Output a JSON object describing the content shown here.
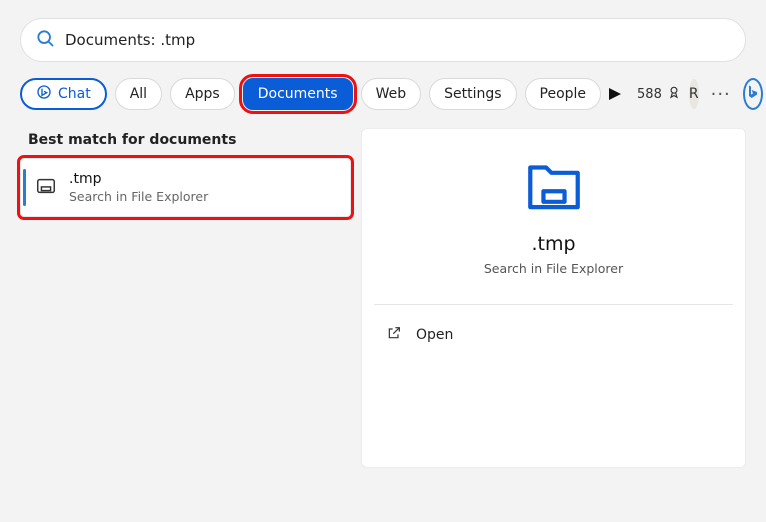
{
  "search": {
    "value": "Documents: .tmp"
  },
  "filters": {
    "chat": "Chat",
    "all": "All",
    "apps": "Apps",
    "documents": "Documents",
    "web": "Web",
    "settings": "Settings",
    "people": "People"
  },
  "toolbar": {
    "points": "588",
    "avatar_initial": "R"
  },
  "left": {
    "section_title": "Best match for documents",
    "result": {
      "title": ".tmp",
      "subtitle": "Search in File Explorer"
    }
  },
  "right": {
    "title": ".tmp",
    "subtitle": "Search in File Explorer",
    "action_open": "Open"
  }
}
